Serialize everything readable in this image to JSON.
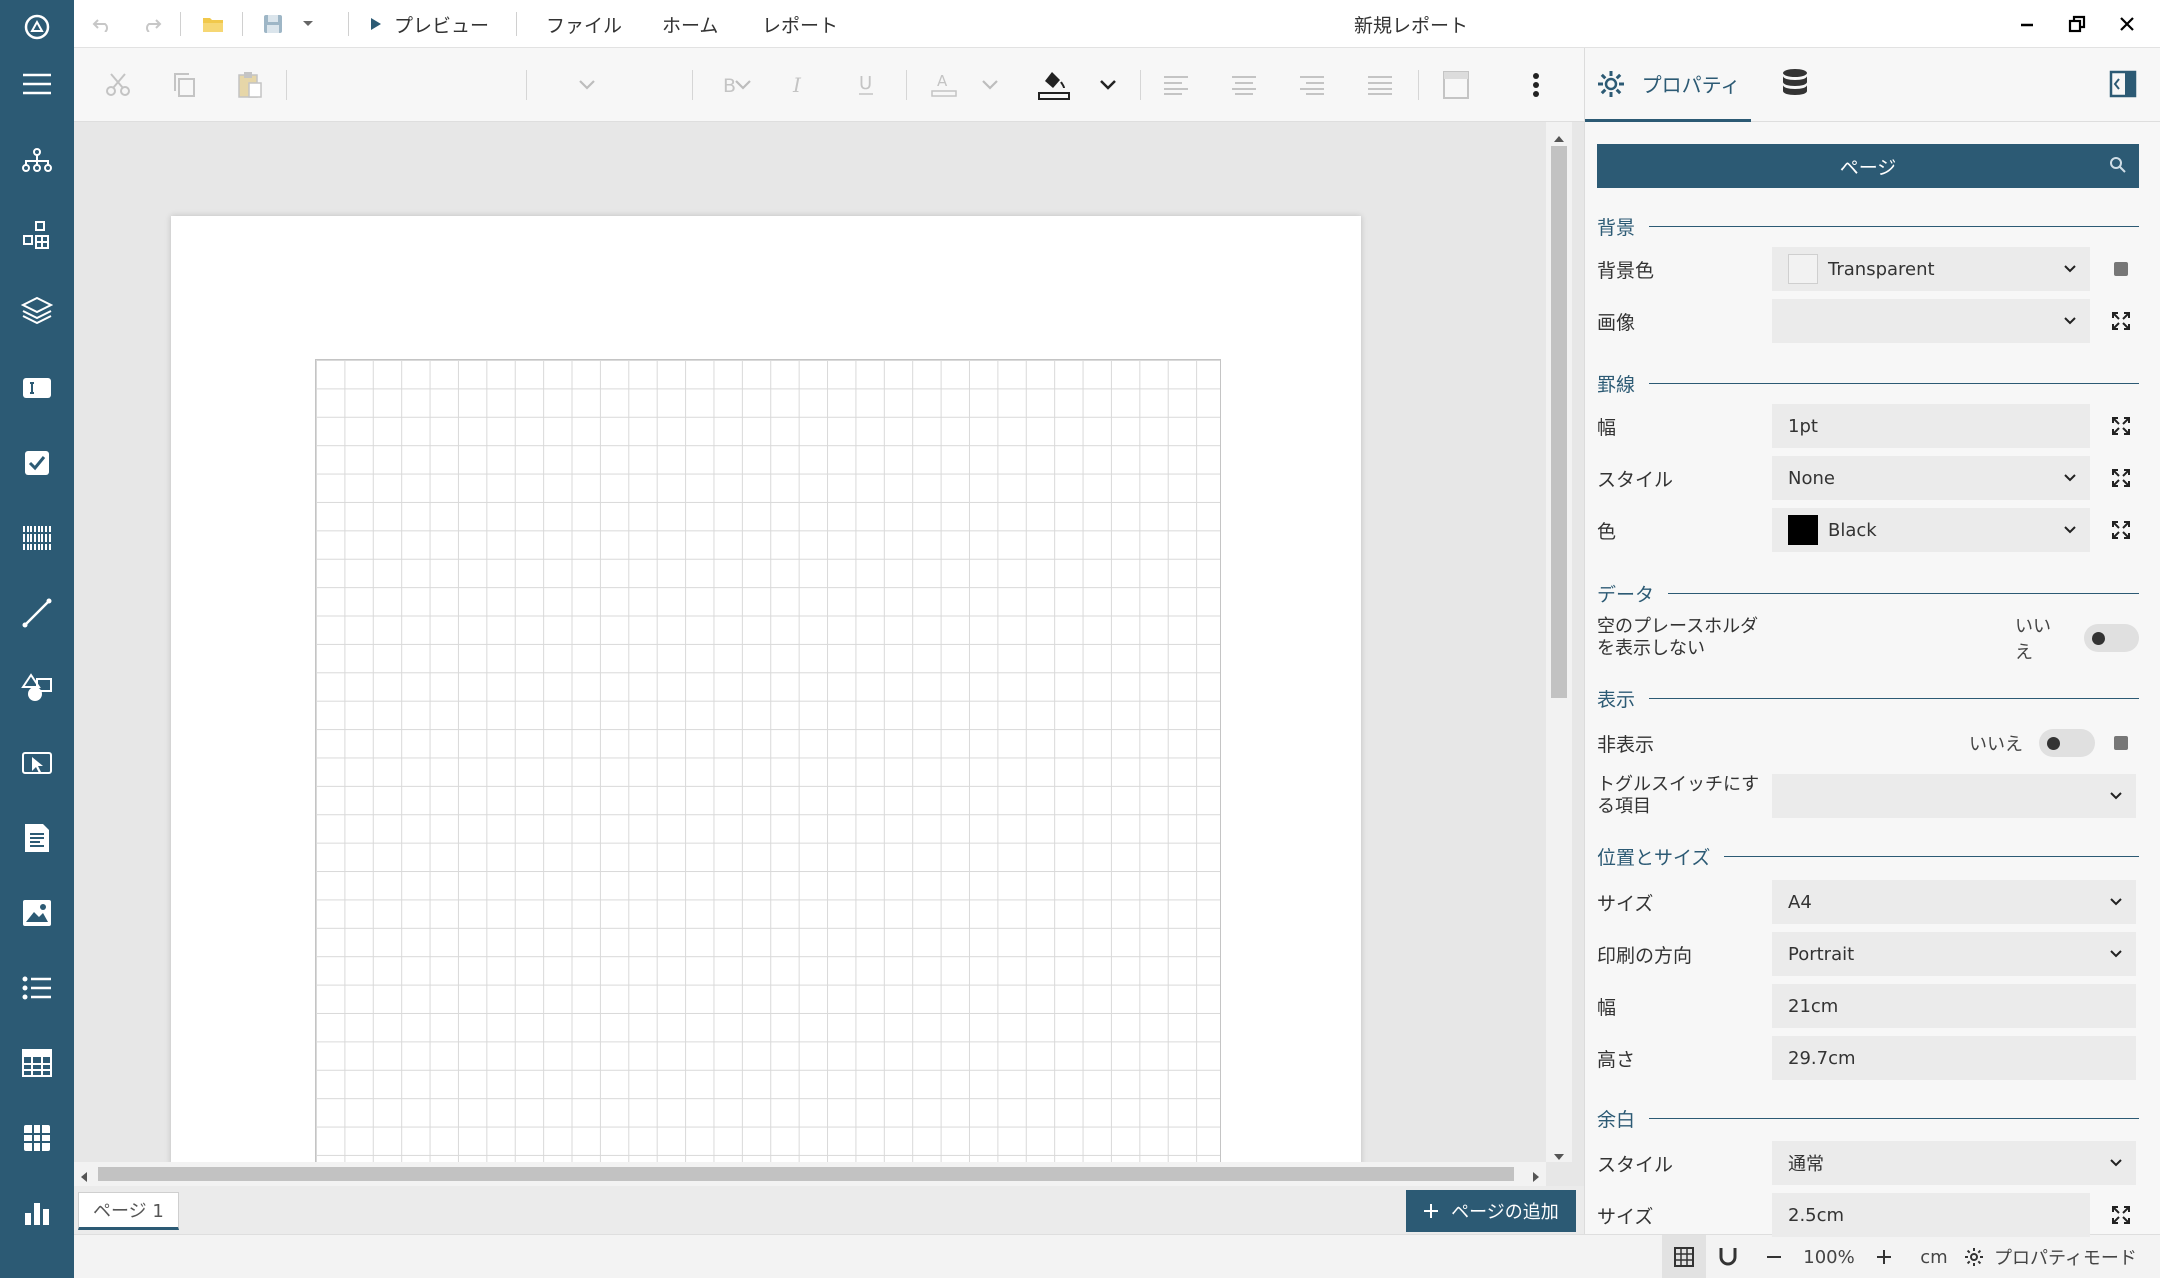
{
  "app": {
    "window_title": "新規レポート"
  },
  "menubar": {
    "preview_label": "プレビュー",
    "menus": [
      "ファイル",
      "ホーム",
      "レポート"
    ]
  },
  "canvas": {
    "page_tab": "ページ 1",
    "add_page_label": "ページの追加"
  },
  "statusbar": {
    "zoom": "100%",
    "unit": "cm",
    "property_mode": "プロパティモード"
  },
  "panel": {
    "tab_properties": "プロパティ",
    "search_value": "ページ",
    "sections": {
      "background": "背景",
      "border": "罫線",
      "data": "データ",
      "display": "表示",
      "position_size": "位置とサイズ",
      "margin": "余白"
    },
    "background": {
      "color_label": "背景色",
      "color_value": "Transparent",
      "image_label": "画像",
      "image_value": ""
    },
    "border": {
      "width_label": "幅",
      "width_value": "1pt",
      "style_label": "スタイル",
      "style_value": "None",
      "color_label": "色",
      "color_value": "Black"
    },
    "data": {
      "hide_empty_label": "空のプレースホルダを表示しない",
      "hide_empty_value": "いいえ"
    },
    "display": {
      "hidden_label": "非表示",
      "hidden_value": "いいえ",
      "toggle_item_label": "トグルスイッチにする項目",
      "toggle_item_value": ""
    },
    "position_size": {
      "size_label": "サイズ",
      "size_value": "A4",
      "orientation_label": "印刷の方向",
      "orientation_value": "Portrait",
      "width_label": "幅",
      "width_value": "21cm",
      "height_label": "高さ",
      "height_value": "29.7cm"
    },
    "margin": {
      "style_label": "スタイル",
      "style_value": "通常",
      "size_label": "サイズ",
      "size_value": "2.5cm"
    }
  },
  "colors": {
    "accent": "#2c5a74",
    "sidebar": "#2c5a74",
    "toolbar_bg": "#f7f7f7"
  }
}
